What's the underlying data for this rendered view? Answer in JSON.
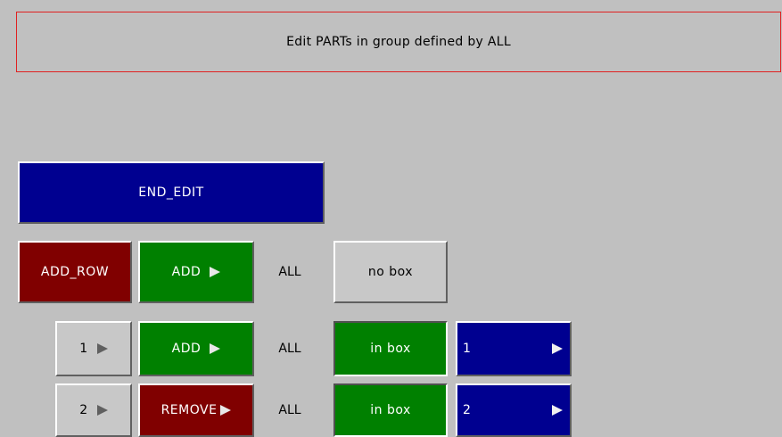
{
  "header": {
    "title": "Edit PARTs in group defined by ALL"
  },
  "toolbar": {
    "end_edit_label": "END_EDIT"
  },
  "add_row": {
    "add_row_label": "ADD_ROW",
    "op_label": "ADD",
    "target_label": "ALL",
    "box_label": "no box"
  },
  "rows": [
    {
      "index": "1",
      "op_label": "ADD",
      "target_label": "ALL",
      "box_label": "in box",
      "box_value": "1"
    },
    {
      "index": "2",
      "op_label": "REMOVE",
      "target_label": "ALL",
      "box_label": "in box",
      "box_value": "2"
    }
  ],
  "colors": {
    "navy": "#000090",
    "maroon": "#800000",
    "green": "#008000",
    "background": "#c0c0c0",
    "title_border": "#e02020"
  }
}
